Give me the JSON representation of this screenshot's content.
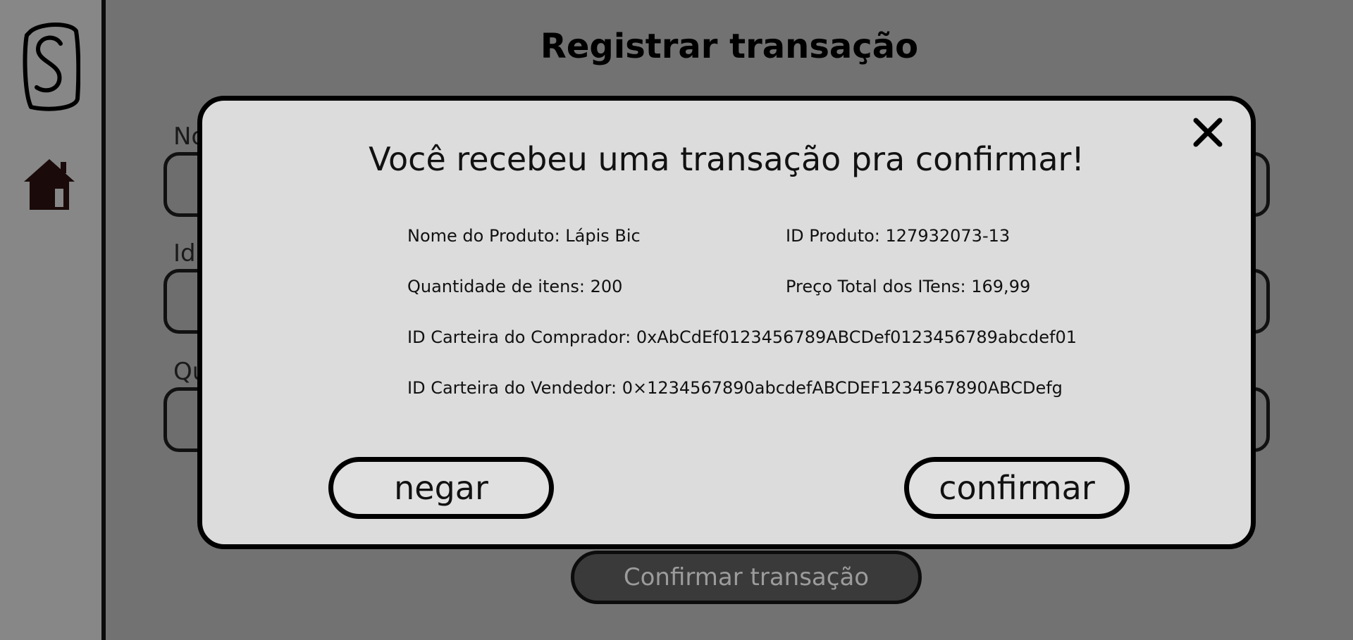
{
  "page": {
    "title": "Registrar transação",
    "background_labels": [
      "No",
      "Id",
      "Qu"
    ],
    "confirm_button": "Confirmar transação"
  },
  "sidebar": {
    "logo": "logo-s-icon",
    "home": "home-icon"
  },
  "modal": {
    "close": "close-icon",
    "heading": "Você recebeu uma transação pra confirmar!",
    "product_name": "Nome do Produto: Lápis Bic",
    "product_id": "ID Produto: 127932073-13",
    "quantity": "Quantidade de itens: 200",
    "total_price": "Preço Total dos ITens: 169,99",
    "buyer_wallet": "ID Carteira do Comprador: 0xAbCdEf0123456789ABCDef0123456789abcdef01",
    "seller_wallet": "ID Carteira do Vendedor: 0×1234567890abcdefABCDEF1234567890ABCDefg",
    "deny_label": "negar",
    "confirm_label": "confirmar"
  },
  "colors": {
    "overlay_bg": "#727272",
    "sidebar_bg": "#878787",
    "modal_bg": "#dcdcdc",
    "home_icon": "#1a0a0a"
  }
}
